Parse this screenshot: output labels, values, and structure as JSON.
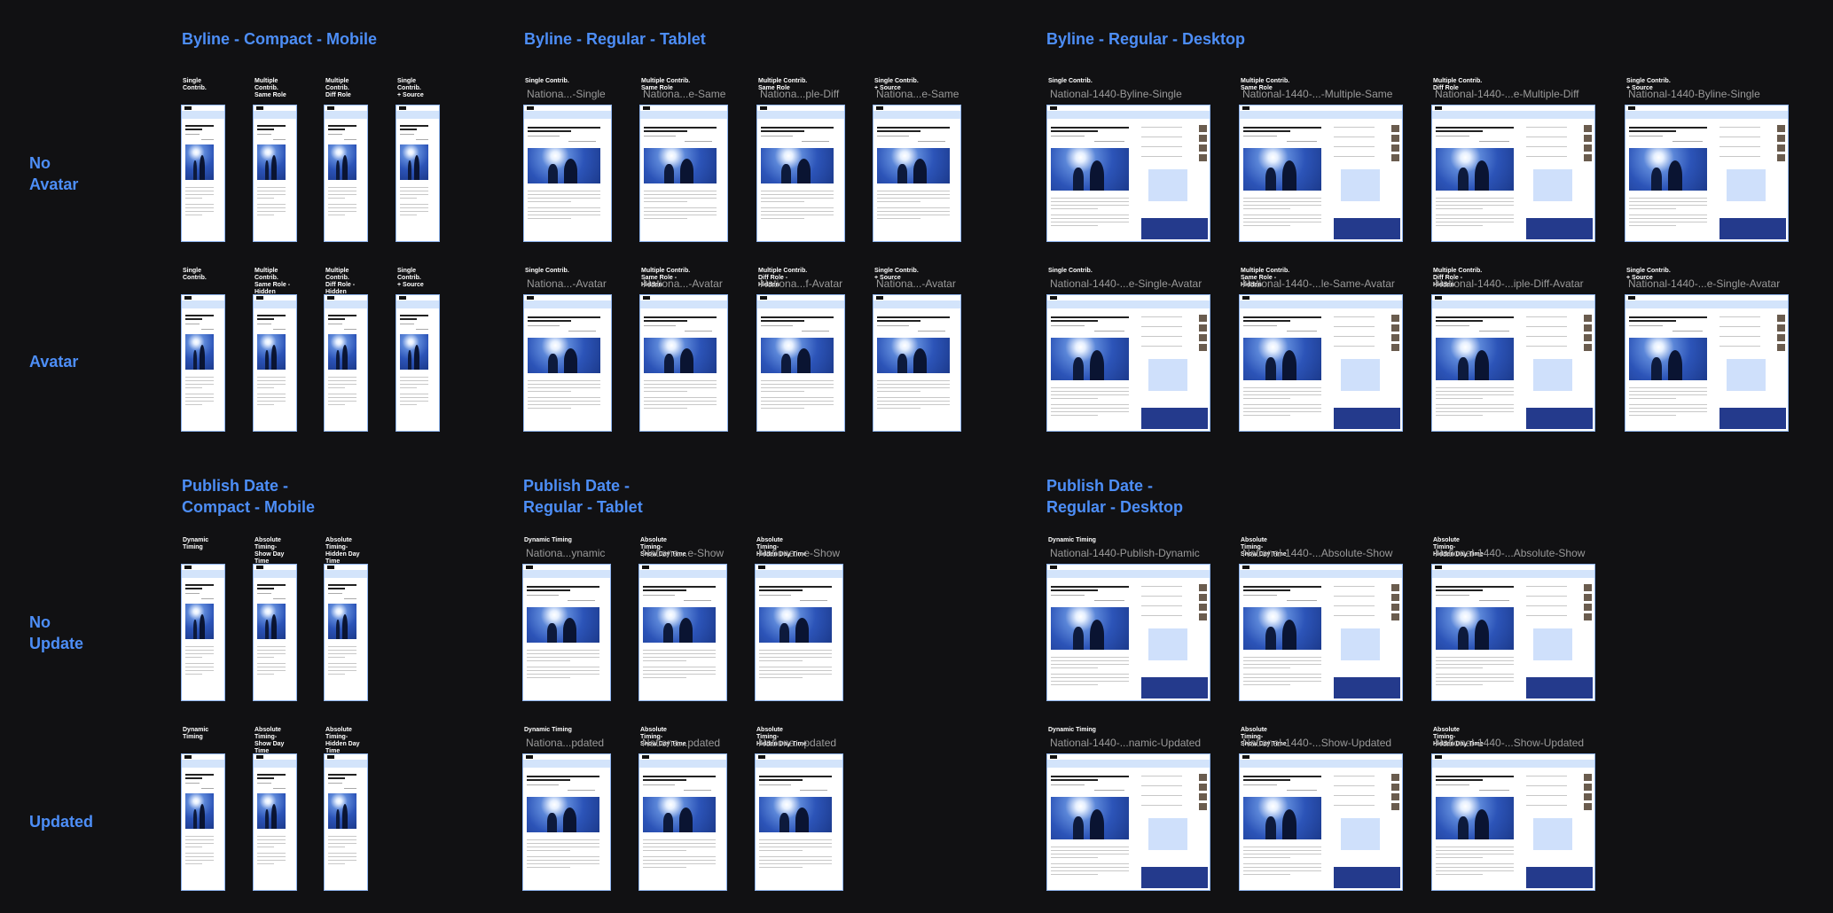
{
  "sections": {
    "byline_mobile": "Byline - Compact - Mobile",
    "byline_tablet": "Byline - Regular - Tablet",
    "byline_desktop": "Byline - Regular - Desktop",
    "publish_mobile": "Publish Date -\nCompact - Mobile",
    "publish_tablet": "Publish Date -\nRegular - Tablet",
    "publish_desktop": "Publish Date -\nRegular - Desktop"
  },
  "row_labels": {
    "no_avatar": "No\nAvatar",
    "avatar": "Avatar",
    "no_update": "No\nUpdate",
    "updated": "Updated"
  },
  "frames": [
    {
      "cap": "Single Contrib.",
      "name": ""
    },
    {
      "cap": "Multiple Contrib.\nSame Role",
      "name": ""
    },
    {
      "cap": "Multiple Contrib.\nDiff Role",
      "name": ""
    },
    {
      "cap": "Single Contrib.\n+ Source",
      "name": ""
    },
    {
      "cap": "Single Contrib.",
      "name": ""
    },
    {
      "cap": "Multiple Contrib.\nSame Role -\nHidden",
      "name": ""
    },
    {
      "cap": "Multiple Contrib.\nDiff Role -\nHidden",
      "name": ""
    },
    {
      "cap": "Single Contrib.\n+ Source",
      "name": ""
    },
    {
      "cap": "Single Contrib.",
      "name": "Nationa...-Single"
    },
    {
      "cap": "Multiple Contrib.\nSame Role",
      "name": "Nationa...e-Same"
    },
    {
      "cap": "Multiple Contrib.\nSame Role",
      "name": "Nationa...ple-Diff"
    },
    {
      "cap": "Single Contrib.\n+ Source",
      "name": "Nationa...e-Same"
    },
    {
      "cap": "Single Contrib.",
      "name": "Nationa...-Avatar"
    },
    {
      "cap": "Multiple Contrib.\nSame Role -\nHidden",
      "name": "Nationa...-Avatar"
    },
    {
      "cap": "Multiple Contrib.\nDiff Role -\nHidden",
      "name": "Nationa...f-Avatar"
    },
    {
      "cap": "Single Contrib.\n+ Source",
      "name": "Nationa...-Avatar"
    },
    {
      "cap": "Single Contrib.",
      "name": "National-1440-Byline-Single"
    },
    {
      "cap": "Multiple Contrib.\nSame Role",
      "name": "National-1440-...-Multiple-Same"
    },
    {
      "cap": "Multiple Contrib.\nDiff Role",
      "name": "National-1440-...e-Multiple-Diff"
    },
    {
      "cap": "Single Contrib.\n+ Source",
      "name": "National-1440-Byline-Single"
    },
    {
      "cap": "Single Contrib.",
      "name": "National-1440-...e-Single-Avatar"
    },
    {
      "cap": "Multiple Contrib.\nSame Role -\nHidden",
      "name": "National-1440-...le-Same-Avatar"
    },
    {
      "cap": "Multiple Contrib.\nDiff Role -\nHidden",
      "name": "National-1440-...iple-Diff-Avatar"
    },
    {
      "cap": "Single Contrib.\n+ Source",
      "name": "National-1440-...e-Single-Avatar"
    },
    {
      "cap": "Dynamic Timing",
      "name": ""
    },
    {
      "cap": "Absolute\nTiming-\nShow Day Time",
      "name": ""
    },
    {
      "cap": "Absolute\nTiming-\nHidden Day Time",
      "name": ""
    },
    {
      "cap": "Dynamic Timing",
      "name": ""
    },
    {
      "cap": "Absolute\nTiming-\nShow Day Time",
      "name": ""
    },
    {
      "cap": "Absolute\nTiming-\nHidden Day Time",
      "name": ""
    },
    {
      "cap": "Dynamic Timing",
      "name": "Nationa...ynamic"
    },
    {
      "cap": "Absolute\nTiming-\nShow Day Time",
      "name": "Nationa...e-Show"
    },
    {
      "cap": "Absolute\nTiming-\nHidden Day Time",
      "name": "Nationa...e-Show"
    },
    {
      "cap": "Dynamic Timing",
      "name": "Nationa...pdated"
    },
    {
      "cap": "Absolute\nTiming-\nShow Day Time",
      "name": "Nationa...pdated"
    },
    {
      "cap": "Absolute\nTiming-\nHidden Day Time",
      "name": "Nationa...pdated"
    },
    {
      "cap": "Dynamic Timing",
      "name": "National-1440-Publish-Dynamic"
    },
    {
      "cap": "Absolute\nTiming-\nShow Day Time",
      "name": "National-1440-...Absolute-Show"
    },
    {
      "cap": "Absolute\nTiming-\nHidden Day Time",
      "name": "National-1440-...Absolute-Show"
    },
    {
      "cap": "Dynamic Timing",
      "name": "National-1440-...namic-Updated"
    },
    {
      "cap": "Absolute\nTiming-\nShow Day Time",
      "name": "National-1440-...Show-Updated"
    },
    {
      "cap": "Absolute\nTiming-\nHidden Day Time",
      "name": "National-1440-...Show-Updated"
    }
  ],
  "colors": {
    "canvas": "#111113",
    "accent": "#4d8ef7",
    "frame_name": "#9a9a9a"
  }
}
